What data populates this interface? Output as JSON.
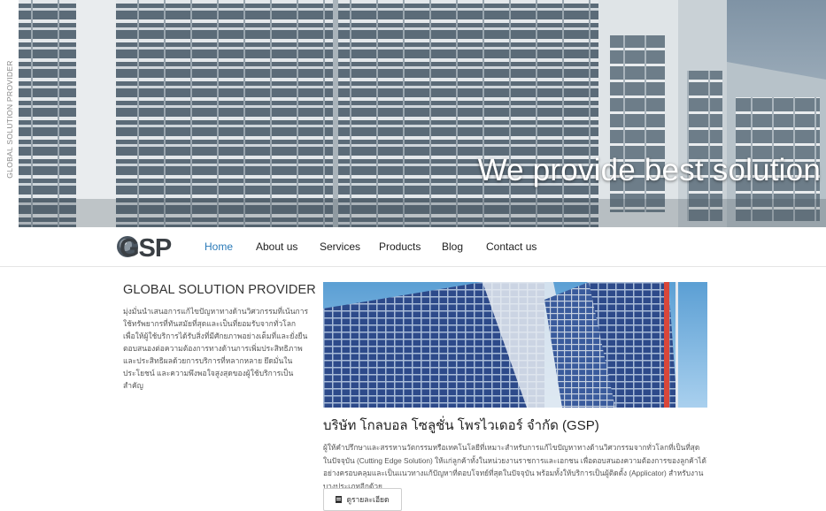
{
  "side_label": "GLOBAL SOLUTION PROVIDER",
  "hero": {
    "slogan": "We provide best solution"
  },
  "logo": {
    "text": "GSP"
  },
  "nav": {
    "items": [
      {
        "label": "Home",
        "active": true
      },
      {
        "label": "About us",
        "active": false
      },
      {
        "label": "Services",
        "active": false
      },
      {
        "label": "Products",
        "active": false
      },
      {
        "label": "Blog",
        "active": false
      },
      {
        "label": "Contact us",
        "active": false
      }
    ]
  },
  "intro": {
    "title": "GLOBAL SOLUTION PROVIDER",
    "text": "มุ่งมั่นนำเสนอการแก้ไขปัญหาทางด้านวิศวกรรมที่เน้นการใช้ทรัพยากรที่ทันสมัยที่สุดและเป็นที่ยอมรับจากทั่วโลก เพื่อให้ผู้ใช้บริการได้รับสิ่งที่มีศักยภาพอย่างเต็มที่และยั่งยืนตอบสนองต่อความต้องการทางด้านการเพิ่มประสิทธิภาพและประสิทธิผลด้วยการบริการที่หลากหลาย ยึดมั่นในประโยชน์ และความพึงพอใจสูงสุดของผู้ใช้บริการเป็นสำคัญ"
  },
  "company": {
    "title": "บริษัท โกลบอล โซลูชั่น โพรไวเดอร์ จำกัด (GSP)",
    "text": "ผู้ให้คำปรึกษาและสรรหานวัตกรรมหรือเทคโนโลยีที่เหมาะสำหรับการแก้ไขปัญหาทางด้านวิศวกรรมจากทั่วโลกที่เป็นที่สุดในปัจจุบัน (Cutting Edge Solution) ให้แก่ลูกค้าทั้งในหน่วยงานราชการและเอกชน เพื่อตอบสนองความต้องการของลูกค้าได้อย่างครอบคลุมและเป็นแนวทางแก้ปัญหาที่ตอบโจทย์ที่สุดในปัจจุบัน พร้อมทั้งให้บริการเป็นผู้ติดตั้ง (Applicator) สำหรับงานบางประเภทอีกด้วย",
    "more_label": "ดูรายละเอียด"
  },
  "colors": {
    "nav_active": "#2a7ab8",
    "border": "#e5e5e5"
  }
}
